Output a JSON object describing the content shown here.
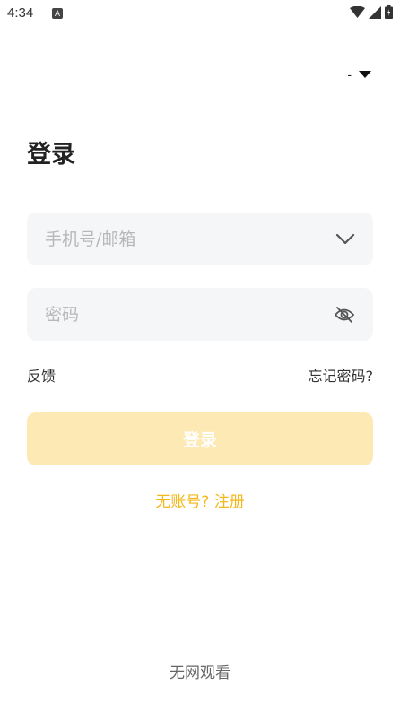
{
  "status_bar": {
    "time": "4:34",
    "notification_icon": "a-icon"
  },
  "language": {
    "label": "-"
  },
  "page": {
    "title": "登录"
  },
  "form": {
    "account_placeholder": "手机号/邮箱",
    "password_placeholder": "密码",
    "feedback_label": "反馈",
    "forgot_password_label": "忘记密码?",
    "login_button_label": "登录"
  },
  "links": {
    "register_label": "无账号? 注册",
    "offline_label": "无网观看"
  },
  "colors": {
    "accent": "#f5b81c",
    "login_button_disabled": "#fde9b4",
    "field_background": "#f5f6f8"
  }
}
